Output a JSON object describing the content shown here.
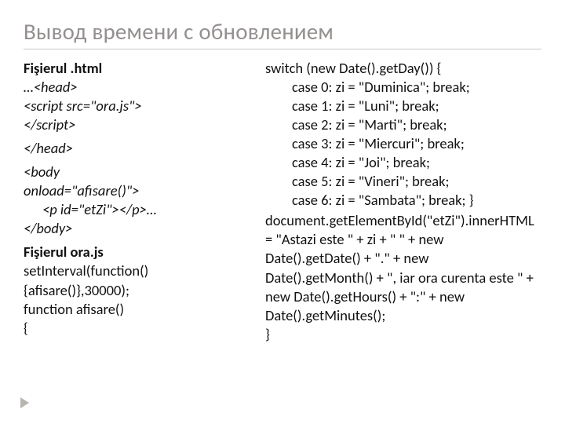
{
  "title": "Вывод  времени с обновлением",
  "left": {
    "h1": "Fişierul .html",
    "l1a": "…",
    "l1b": "<head>",
    "l2": "<script src=\"ora.js\">",
    "l3": "</script>",
    "l4": "</head>",
    "l5a": "<body",
    "l5b": "onload=\"afisare()\">",
    "l6a": "    <p id=\"etZi\"></p>",
    "l6b": "…",
    "l7": "</body>",
    "h2": "Fişierul ora.js",
    "l8": "setInterval(function() {afisare()},30000);",
    "l9": "function afisare()",
    "l10": "{"
  },
  "right": {
    "r1": "switch (new Date().getDay()) {",
    "r2": "case 0:  zi = \"Duminica\";  break;",
    "r3": "case 1:   zi = \"Luni\";  break;",
    "r4": "case 2:   zi = \"Marti\";  break;",
    "r5": "case 3:   zi = \"Miercuri\";  break;",
    "r6": "case 4:   zi = \"Joi\";  break;",
    "r7": "case 5:   zi = \"Vineri\";  break;",
    "r8": "case  6:  zi = \"Sambata\";  break; }",
    "r9": "document.getElementById(\"etZi\").innerHTML = \"Astazi este \" + zi + \"   \" + new Date().getDate() + \".\" + new Date().getMonth() + \", iar ora curenta este \" + new Date().getHours() + \":\" + new Date().getMinutes();",
    "r10": "}"
  }
}
